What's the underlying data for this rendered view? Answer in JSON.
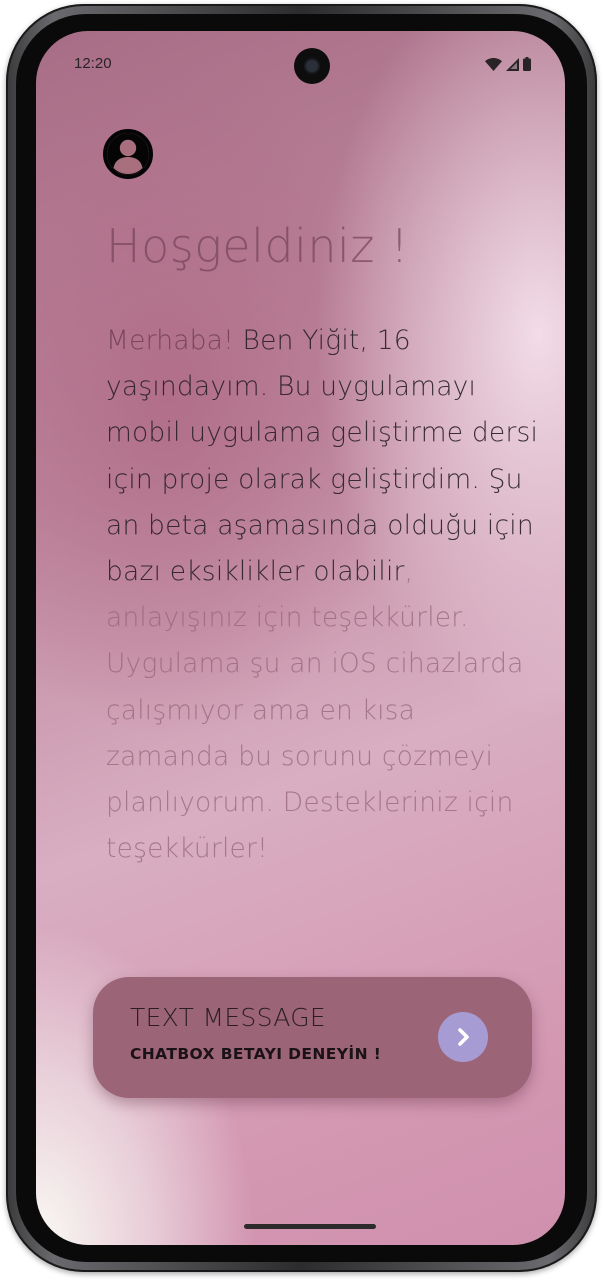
{
  "status_bar": {
    "time": "12:20",
    "icons": [
      "wifi-icon",
      "signal-icon",
      "battery-icon"
    ]
  },
  "profile": {
    "icon": "user-avatar-icon"
  },
  "welcome": {
    "title": "Hoşgeldiniz !",
    "intro_lead": "Merhaba!",
    "intro_body": " Ben Yiğit, 16 yaşındayım. Bu uygulamayı mobil uygulama geliştirme dersi için proje olarak geliştirdim. Şu an beta aşamasında olduğu için bazı eksiklikler olabilir",
    "intro_tail": ", anlayışınız için teşekkürler. Uygulama şu an iOS cihazlarda çalışmıyor ama en kısa zamanda bu sorunu çözmeyi planlıyorum. Destekleriniz için teşekkürler!"
  },
  "cta": {
    "title": "TEXT MESSAGE",
    "subtitle": "CHATBOX BETAYI DENEYİN !",
    "arrow_icon": "chevron-right-icon"
  },
  "colors": {
    "card": "#9c6477",
    "arrow_button": "#a79bd3",
    "text_dark": "#2e2428"
  }
}
